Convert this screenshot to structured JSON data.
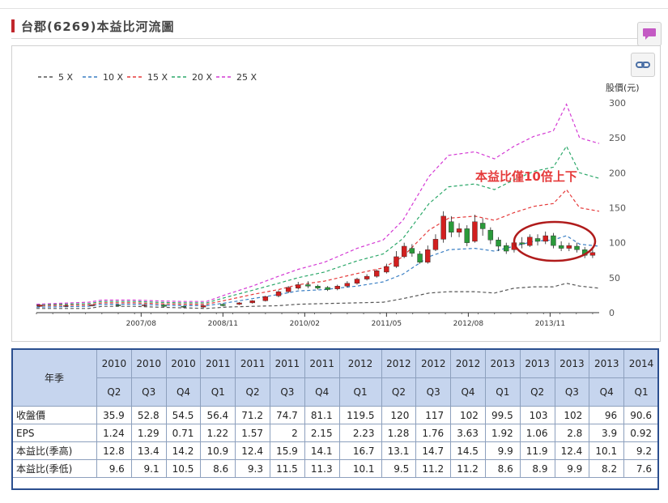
{
  "page": {
    "title": "台郡(6269)本益比河流圖"
  },
  "icons": {
    "chat": "speech-bubble-icon",
    "link": "chain-link-icon"
  },
  "chart_data": {
    "type": "line",
    "title": "",
    "ylabel": "股價(元)",
    "ylim": [
      0,
      300
    ],
    "yticks": [
      0,
      50,
      100,
      150,
      200,
      250,
      300
    ],
    "xticks": [
      "2007/08",
      "2008/11",
      "2010/02",
      "2011/05",
      "2012/08",
      "2013/11"
    ],
    "xlim": [
      2006.0,
      2014.6
    ],
    "legend_position": "top-left",
    "series": [
      {
        "name": "5 X",
        "color": "#555555",
        "points": [
          [
            2006.0,
            6
          ],
          [
            2006.8,
            6
          ],
          [
            2007.0,
            9
          ],
          [
            2007.5,
            9
          ],
          [
            2007.8,
            8
          ],
          [
            2008.2,
            7
          ],
          [
            2008.6,
            6
          ],
          [
            2008.9,
            8
          ],
          [
            2009.3,
            9
          ],
          [
            2009.7,
            10
          ],
          [
            2010.0,
            12
          ],
          [
            2010.4,
            13
          ],
          [
            2010.9,
            14
          ],
          [
            2011.3,
            15
          ],
          [
            2011.6,
            20
          ],
          [
            2012.0,
            28
          ],
          [
            2012.3,
            30
          ],
          [
            2012.7,
            30
          ],
          [
            2013.0,
            28
          ],
          [
            2013.3,
            35
          ],
          [
            2013.6,
            37
          ],
          [
            2013.9,
            37
          ],
          [
            2014.1,
            42
          ],
          [
            2014.3,
            38
          ],
          [
            2014.6,
            35
          ]
        ]
      },
      {
        "name": "10 X",
        "color": "#3a7fc4",
        "points": [
          [
            2006.0,
            8
          ],
          [
            2006.8,
            9
          ],
          [
            2007.0,
            12
          ],
          [
            2007.5,
            12
          ],
          [
            2007.8,
            11
          ],
          [
            2008.2,
            10
          ],
          [
            2008.6,
            10
          ],
          [
            2008.9,
            14
          ],
          [
            2009.3,
            20
          ],
          [
            2009.7,
            26
          ],
          [
            2010.0,
            31
          ],
          [
            2010.4,
            33
          ],
          [
            2010.9,
            38
          ],
          [
            2011.3,
            44
          ],
          [
            2011.6,
            55
          ],
          [
            2012.0,
            80
          ],
          [
            2012.3,
            90
          ],
          [
            2012.7,
            92
          ],
          [
            2013.0,
            88
          ],
          [
            2013.3,
            95
          ],
          [
            2013.6,
            102
          ],
          [
            2013.9,
            104
          ],
          [
            2014.1,
            110
          ],
          [
            2014.3,
            98
          ],
          [
            2014.6,
            95
          ]
        ]
      },
      {
        "name": "15 X",
        "color": "#e53a3a",
        "points": [
          [
            2006.0,
            10
          ],
          [
            2006.8,
            11
          ],
          [
            2007.0,
            14
          ],
          [
            2007.5,
            14
          ],
          [
            2007.8,
            13
          ],
          [
            2008.2,
            12
          ],
          [
            2008.6,
            12
          ],
          [
            2008.9,
            18
          ],
          [
            2009.3,
            26
          ],
          [
            2009.7,
            33
          ],
          [
            2010.0,
            40
          ],
          [
            2010.4,
            45
          ],
          [
            2010.9,
            56
          ],
          [
            2011.3,
            64
          ],
          [
            2011.6,
            80
          ],
          [
            2012.0,
            118
          ],
          [
            2012.3,
            135
          ],
          [
            2012.7,
            138
          ],
          [
            2013.0,
            132
          ],
          [
            2013.3,
            143
          ],
          [
            2013.6,
            152
          ],
          [
            2013.9,
            156
          ],
          [
            2014.1,
            176
          ],
          [
            2014.3,
            150
          ],
          [
            2014.6,
            145
          ]
        ]
      },
      {
        "name": "20 X",
        "color": "#2ca86a",
        "points": [
          [
            2006.0,
            11
          ],
          [
            2006.8,
            13
          ],
          [
            2007.0,
            16
          ],
          [
            2007.5,
            16
          ],
          [
            2007.8,
            15
          ],
          [
            2008.2,
            14
          ],
          [
            2008.6,
            14
          ],
          [
            2008.9,
            22
          ],
          [
            2009.3,
            32
          ],
          [
            2009.7,
            42
          ],
          [
            2010.0,
            50
          ],
          [
            2010.4,
            58
          ],
          [
            2010.9,
            74
          ],
          [
            2011.3,
            84
          ],
          [
            2011.6,
            106
          ],
          [
            2012.0,
            156
          ],
          [
            2012.3,
            180
          ],
          [
            2012.7,
            184
          ],
          [
            2013.0,
            176
          ],
          [
            2013.3,
            190
          ],
          [
            2013.6,
            202
          ],
          [
            2013.9,
            208
          ],
          [
            2014.1,
            238
          ],
          [
            2014.3,
            200
          ],
          [
            2014.6,
            192
          ]
        ]
      },
      {
        "name": "25 X",
        "color": "#d43ad4",
        "points": [
          [
            2006.0,
            12
          ],
          [
            2006.8,
            15
          ],
          [
            2007.0,
            18
          ],
          [
            2007.5,
            18
          ],
          [
            2007.8,
            17
          ],
          [
            2008.2,
            16
          ],
          [
            2008.6,
            16
          ],
          [
            2008.9,
            26
          ],
          [
            2009.3,
            38
          ],
          [
            2009.7,
            52
          ],
          [
            2010.0,
            62
          ],
          [
            2010.4,
            72
          ],
          [
            2010.9,
            92
          ],
          [
            2011.3,
            104
          ],
          [
            2011.6,
            132
          ],
          [
            2012.0,
            195
          ],
          [
            2012.3,
            225
          ],
          [
            2012.7,
            230
          ],
          [
            2013.0,
            220
          ],
          [
            2013.3,
            238
          ],
          [
            2013.6,
            252
          ],
          [
            2013.9,
            260
          ],
          [
            2014.1,
            298
          ],
          [
            2014.3,
            250
          ],
          [
            2014.6,
            242
          ]
        ]
      }
    ],
    "price_candles": [
      [
        2006.05,
        9,
        11,
        8,
        12
      ],
      [
        2006.45,
        10,
        10,
        9,
        11
      ],
      [
        2006.85,
        10,
        11,
        9,
        12
      ],
      [
        2007.25,
        11,
        10,
        9,
        12
      ],
      [
        2007.65,
        10,
        11,
        9,
        12
      ],
      [
        2007.95,
        11,
        9,
        8,
        12
      ],
      [
        2008.25,
        9,
        8,
        7,
        10
      ],
      [
        2008.55,
        8,
        10,
        7,
        11
      ],
      [
        2008.85,
        12,
        10,
        9,
        13
      ],
      [
        2009.1,
        12,
        14,
        11,
        15
      ],
      [
        2009.3,
        14,
        17,
        13,
        18
      ],
      [
        2009.5,
        17,
        23,
        16,
        24
      ],
      [
        2009.7,
        24,
        30,
        22,
        32
      ],
      [
        2009.85,
        30,
        36,
        28,
        38
      ],
      [
        2010.0,
        35,
        40,
        33,
        44
      ],
      [
        2010.15,
        40,
        38,
        35,
        45
      ],
      [
        2010.3,
        38,
        35,
        33,
        40
      ],
      [
        2010.45,
        36,
        33,
        31,
        38
      ],
      [
        2010.6,
        34,
        38,
        32,
        40
      ],
      [
        2010.75,
        38,
        42,
        36,
        45
      ],
      [
        2010.9,
        42,
        48,
        40,
        50
      ],
      [
        2011.05,
        48,
        52,
        46,
        55
      ],
      [
        2011.2,
        52,
        60,
        50,
        62
      ],
      [
        2011.35,
        58,
        66,
        56,
        70
      ],
      [
        2011.5,
        66,
        80,
        64,
        88
      ],
      [
        2011.62,
        80,
        95,
        78,
        100
      ],
      [
        2011.74,
        92,
        85,
        80,
        98
      ],
      [
        2011.86,
        84,
        72,
        70,
        88
      ],
      [
        2011.98,
        72,
        90,
        70,
        96
      ],
      [
        2012.1,
        90,
        105,
        88,
        112
      ],
      [
        2012.22,
        105,
        138,
        100,
        145
      ],
      [
        2012.34,
        130,
        115,
        108,
        138
      ],
      [
        2012.46,
        115,
        120,
        108,
        128
      ],
      [
        2012.58,
        120,
        100,
        95,
        125
      ],
      [
        2012.7,
        102,
        130,
        100,
        140
      ],
      [
        2012.82,
        128,
        120,
        110,
        135
      ],
      [
        2012.94,
        118,
        104,
        98,
        122
      ],
      [
        2013.06,
        104,
        95,
        88,
        108
      ],
      [
        2013.18,
        96,
        88,
        84,
        100
      ],
      [
        2013.3,
        90,
        100,
        86,
        104
      ],
      [
        2013.42,
        100,
        98,
        92,
        108
      ],
      [
        2013.54,
        96,
        108,
        94,
        112
      ],
      [
        2013.66,
        106,
        102,
        96,
        112
      ],
      [
        2013.78,
        102,
        110,
        98,
        116
      ],
      [
        2013.9,
        110,
        96,
        92,
        114
      ],
      [
        2014.02,
        96,
        92,
        88,
        102
      ],
      [
        2014.14,
        92,
        96,
        88,
        100
      ],
      [
        2014.26,
        95,
        90,
        86,
        100
      ],
      [
        2014.38,
        90,
        82,
        78,
        94
      ],
      [
        2014.5,
        82,
        86,
        78,
        90
      ]
    ],
    "annotation": {
      "text": "本益比僅10倍上下",
      "color": "#e53a3a"
    },
    "grid": false
  },
  "table": {
    "row_header": "年季",
    "years": [
      "2010",
      "2010",
      "2010",
      "2011",
      "2011",
      "2011",
      "2011",
      "2012",
      "2012",
      "2012",
      "2012",
      "2013",
      "2013",
      "2013",
      "2013",
      "2014"
    ],
    "quarters": [
      "Q2",
      "Q3",
      "Q4",
      "Q1",
      "Q2",
      "Q3",
      "Q4",
      "Q1",
      "Q2",
      "Q3",
      "Q4",
      "Q1",
      "Q2",
      "Q3",
      "Q4",
      "Q1"
    ],
    "rows": [
      {
        "label": "收盤價",
        "values": [
          "35.9",
          "52.8",
          "54.5",
          "56.4",
          "71.2",
          "74.7",
          "81.1",
          "119.5",
          "120",
          "117",
          "102",
          "99.5",
          "103",
          "102",
          "96",
          "90.6"
        ]
      },
      {
        "label": "EPS",
        "values": [
          "1.24",
          "1.29",
          "0.71",
          "1.22",
          "1.57",
          "2",
          "2.15",
          "2.23",
          "1.28",
          "1.76",
          "3.63",
          "1.92",
          "1.06",
          "2.8",
          "3.9",
          "0.92"
        ]
      },
      {
        "label": "本益比(季高)",
        "values": [
          "12.8",
          "13.4",
          "14.2",
          "10.9",
          "12.4",
          "15.9",
          "14.1",
          "16.7",
          "13.1",
          "14.7",
          "14.5",
          "9.9",
          "11.9",
          "12.4",
          "10.1",
          "9.2"
        ]
      },
      {
        "label": "本益比(季低)",
        "values": [
          "9.6",
          "9.1",
          "10.5",
          "8.6",
          "9.3",
          "11.5",
          "11.3",
          "10.1",
          "9.5",
          "11.2",
          "11.2",
          "8.6",
          "8.9",
          "9.9",
          "8.2",
          "7.6"
        ]
      }
    ]
  }
}
